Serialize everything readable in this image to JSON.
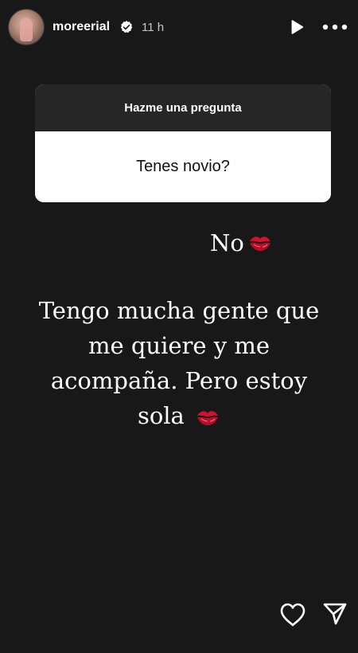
{
  "header": {
    "username": "moreerial",
    "time": "11 h",
    "avatar_icon": "profile-photo",
    "verified_icon": "verified-badge-icon",
    "play_icon": "play-icon",
    "more_icon": "more-horizontal-icon"
  },
  "question_sticker": {
    "title": "Hazme una pregunta",
    "question": "Tenes novio?"
  },
  "answers": {
    "short_text": "No",
    "long_line_1": "Tengo mucha gente que",
    "long_line_2": "me quiere y me",
    "long_line_3": "acompaña. Pero estoy",
    "long_line_4": "sola",
    "emoji": "kiss-mark-icon"
  },
  "footer": {
    "like_icon": "heart-icon",
    "share_icon": "send-icon"
  },
  "colors": {
    "background": "#181818",
    "sticker_header": "#262626",
    "sticker_body": "#ffffff",
    "kiss": "#c8102e"
  }
}
